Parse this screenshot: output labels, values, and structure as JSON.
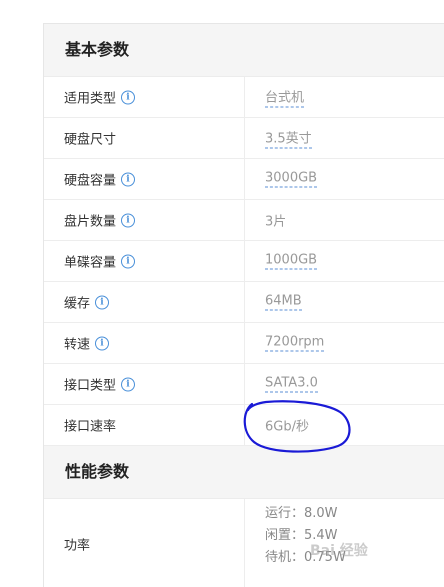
{
  "sections": {
    "basic": {
      "title": "基本参数",
      "rows": [
        {
          "label": "适用类型",
          "value": "台式机"
        },
        {
          "label": "硬盘尺寸",
          "value": "3.5英寸"
        },
        {
          "label": "硬盘容量",
          "value": "3000GB"
        },
        {
          "label": "盘片数量",
          "value": "3片"
        },
        {
          "label": "单碟容量",
          "value": "1000GB"
        },
        {
          "label": "缓存",
          "value": "64MB"
        },
        {
          "label": "转速",
          "value": "7200rpm"
        },
        {
          "label": "接口类型",
          "value": "SATA3.0"
        },
        {
          "label": "接口速率",
          "value": "6Gb/秒"
        }
      ]
    },
    "performance": {
      "title": "性能参数",
      "rows": [
        {
          "label": "功率",
          "lines": [
            "运行：8.0W",
            "闲置：5.4W",
            "待机：0.75W"
          ]
        }
      ]
    }
  },
  "icons": {
    "info": "info-icon"
  },
  "colors": {
    "info_icon": "#4a90d9",
    "annotation_circle": "#1a1ad6",
    "link_underline": "#5b8fd6"
  },
  "watermark": "Bai 经验"
}
